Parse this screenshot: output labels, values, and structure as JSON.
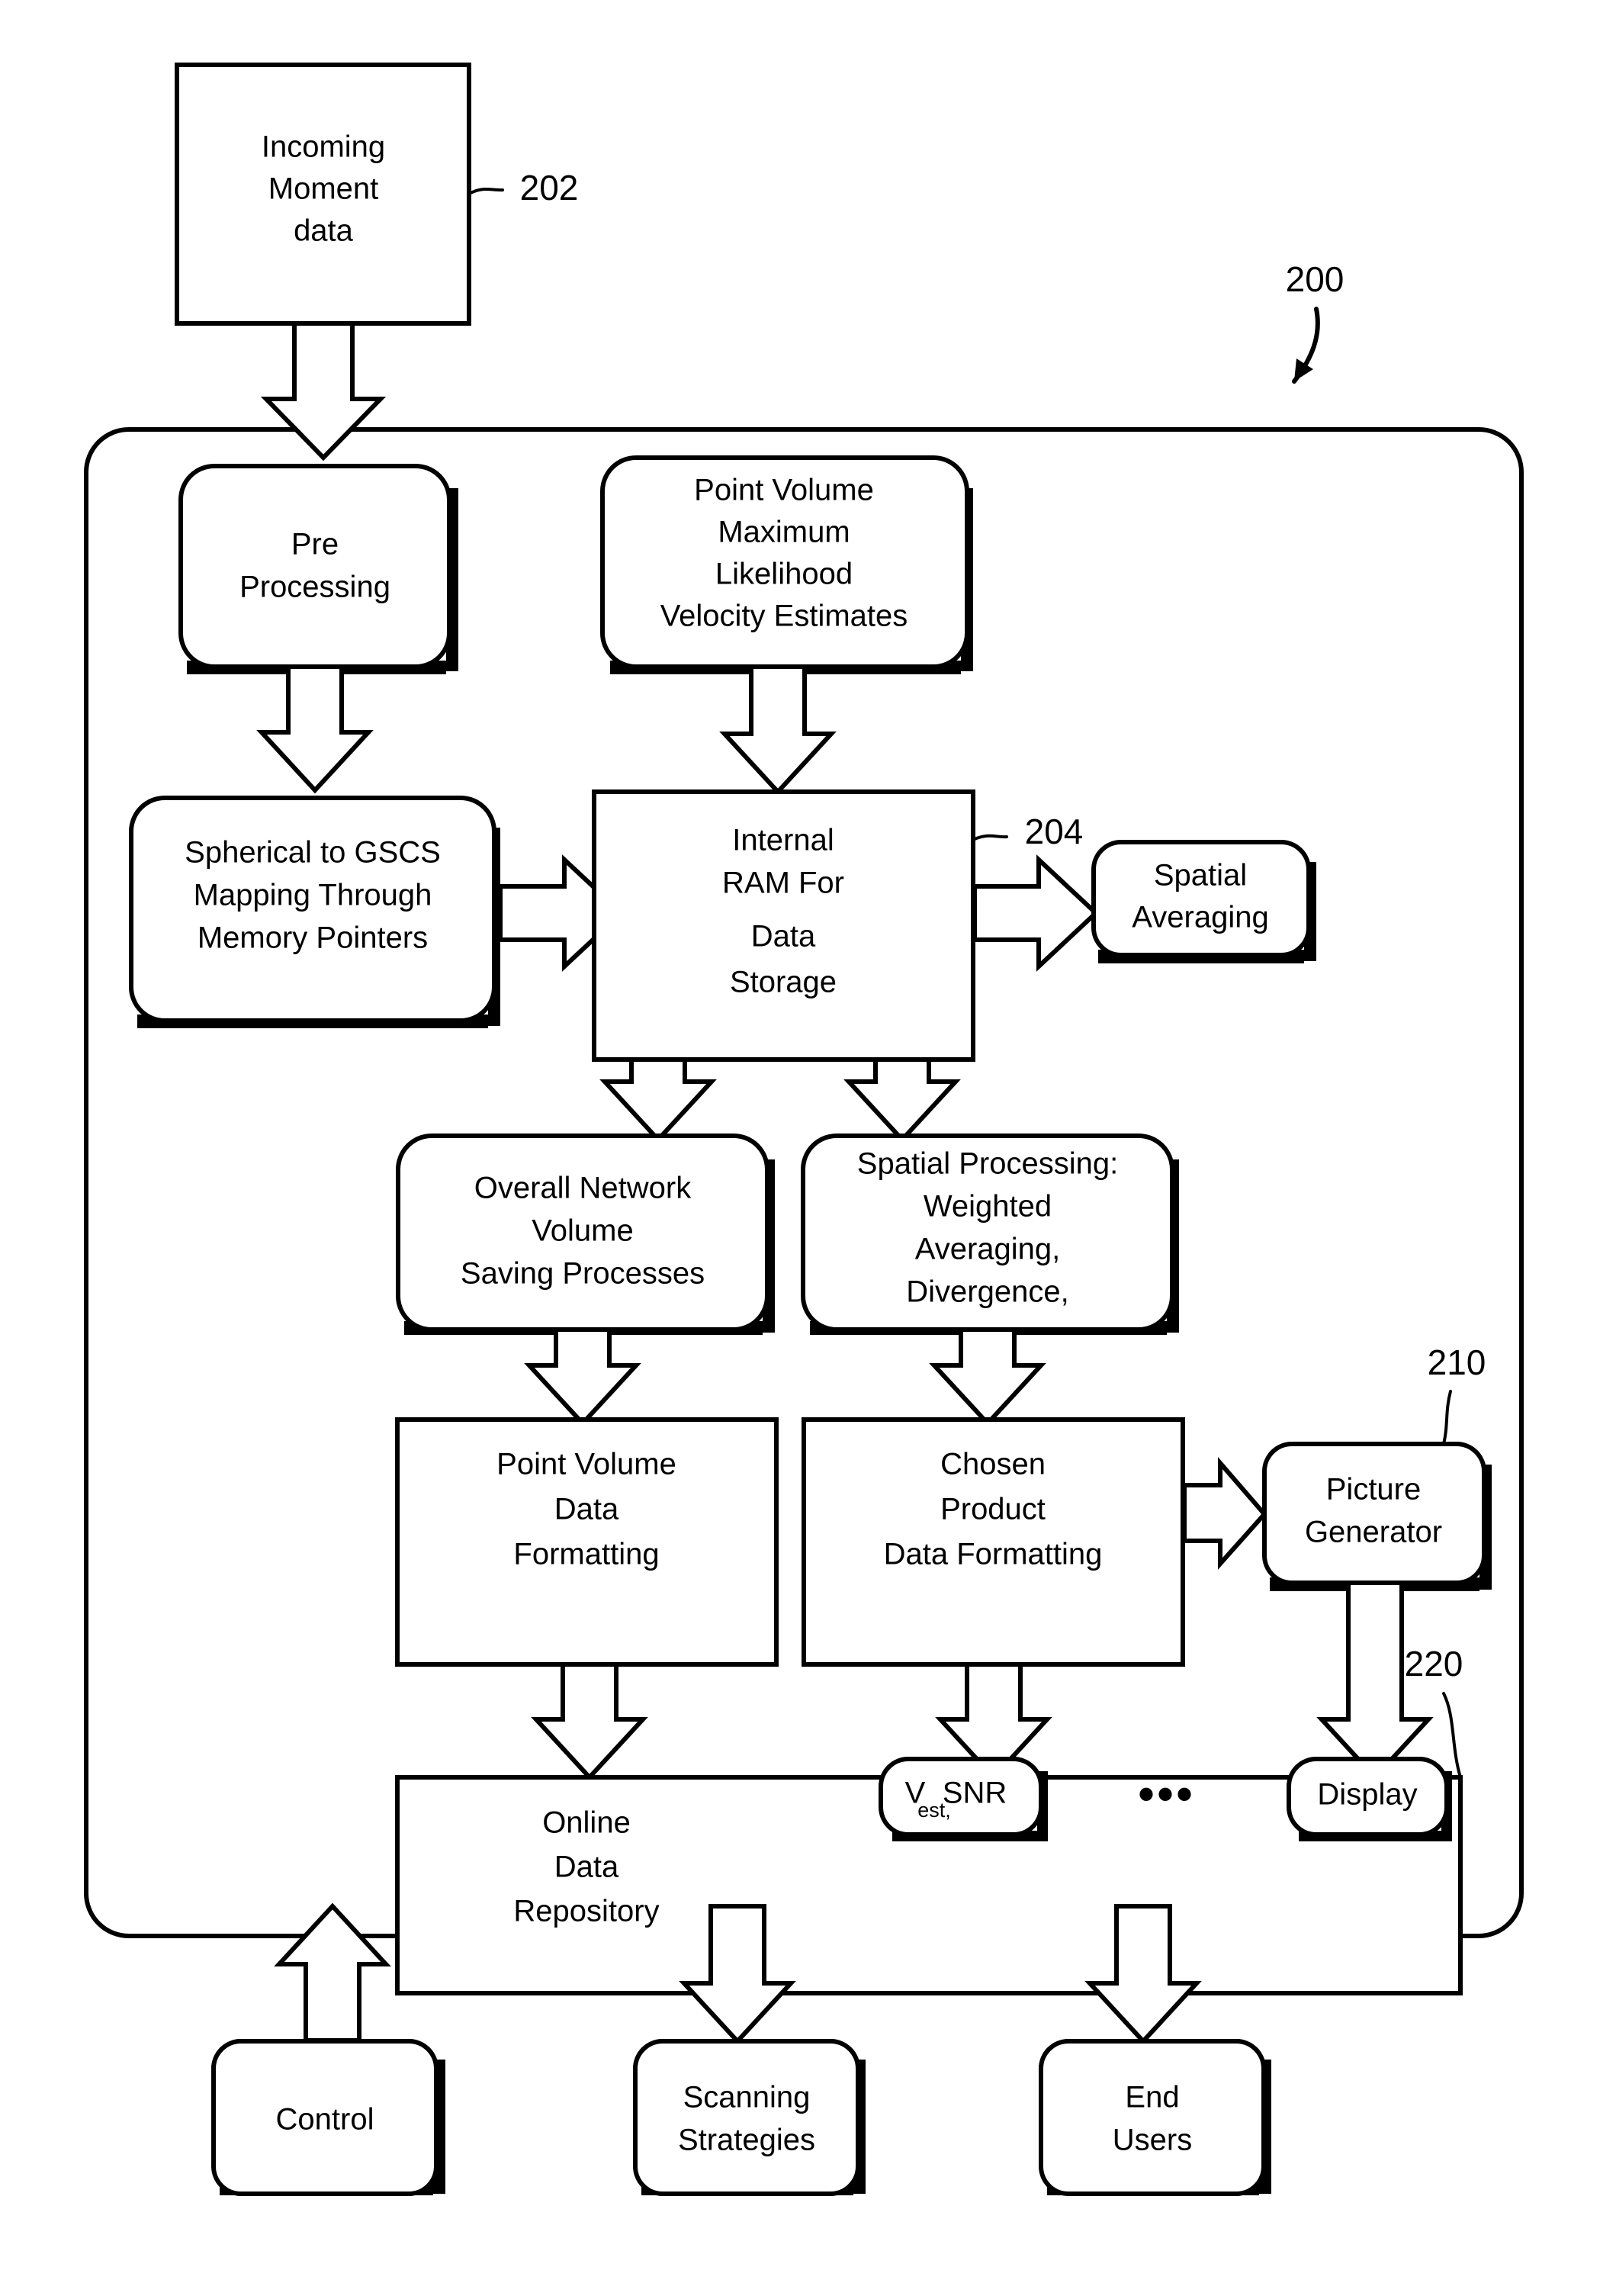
{
  "figure": {
    "reference_numerals": {
      "system": "200",
      "incoming_data": "202",
      "ram": "204",
      "picture_generator": "210",
      "repository": "220"
    }
  },
  "nodes": {
    "incoming_moment_data": {
      "lines": [
        "Incoming",
        "Moment",
        "data"
      ]
    },
    "pre_processing": {
      "lines": [
        "Pre",
        "Processing"
      ]
    },
    "point_volume_mlve": {
      "lines": [
        "Point Volume",
        "Maximum",
        "Likelihood",
        "Velocity Estimates"
      ]
    },
    "spherical_mapping": {
      "lines": [
        "Spherical to GSCS",
        "Mapping Through",
        "Memory Pointers"
      ]
    },
    "internal_ram": {
      "lines": [
        "Internal",
        "RAM For",
        "Data",
        "Storage"
      ]
    },
    "spatial_averaging": {
      "lines": [
        "Spatial",
        "Averaging"
      ]
    },
    "overall_network_volume": {
      "lines": [
        "Overall Network",
        "Volume",
        "Saving Processes"
      ]
    },
    "spatial_processing": {
      "lines": [
        "Spatial Processing:",
        "Weighted",
        "Averaging,",
        "Divergence,"
      ]
    },
    "point_volume_formatting": {
      "lines": [
        "Point Volume",
        "Data",
        "Formatting"
      ]
    },
    "chosen_product_formatting": {
      "lines": [
        "Chosen",
        "Product",
        "Data Formatting"
      ]
    },
    "picture_generator": {
      "lines": [
        "Picture",
        "Generator"
      ]
    },
    "online_data_repository": {
      "lines": [
        "Online",
        "Data",
        "Repository"
      ]
    },
    "control": {
      "lines": [
        "Control"
      ]
    },
    "scanning_strategies": {
      "lines": [
        "Scanning",
        "Strategies"
      ]
    },
    "end_users": {
      "lines": [
        "End",
        "Users"
      ]
    }
  },
  "repository_items": {
    "vest_snr": {
      "base": "V",
      "subscript": "est,",
      "tail": " SNR"
    },
    "ellipsis": "•••",
    "display": "Display"
  },
  "colors": {
    "stroke": "#000000",
    "fill": "#ffffff",
    "background": "#ffffff"
  }
}
